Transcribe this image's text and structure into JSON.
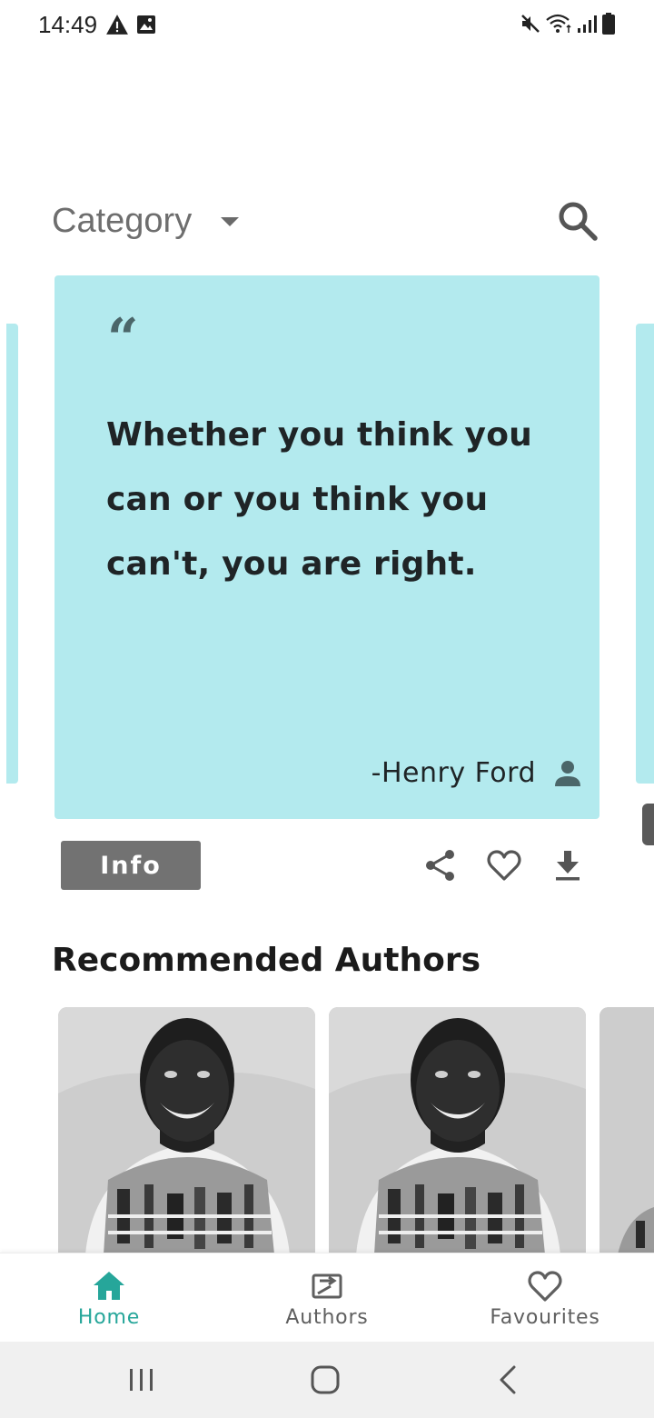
{
  "status_bar": {
    "time": "14:49",
    "icons": [
      "alert-icon",
      "image-icon",
      "mute-icon",
      "wifi-icon",
      "signal-icon",
      "battery-icon"
    ]
  },
  "header": {
    "category_label": "Category",
    "icons": [
      "dropdown-caret-icon",
      "search-icon"
    ]
  },
  "quote_card": {
    "quote_mark": "“",
    "text": "Whether you think you can or you think you can't, you are right.",
    "author": "-Henry Ford",
    "background": "#b3eaee",
    "icons": [
      "person-icon"
    ]
  },
  "actions": {
    "info_label": "Info",
    "icons": [
      "share-icon",
      "heart-outline-icon",
      "download-icon"
    ]
  },
  "recommended": {
    "title": "Recommended Authors"
  },
  "bottom_nav": {
    "items": [
      {
        "label": "Home",
        "icon": "home-icon",
        "active": true
      },
      {
        "label": "Authors",
        "icon": "authors-icon",
        "active": false
      },
      {
        "label": "Favourites",
        "icon": "heart-outline-icon",
        "active": false
      }
    ],
    "active_color": "#26a69a",
    "inactive_color": "#5f5f5f"
  },
  "system_nav": {
    "icons": [
      "recents-icon",
      "home-circle-icon",
      "back-icon"
    ]
  }
}
